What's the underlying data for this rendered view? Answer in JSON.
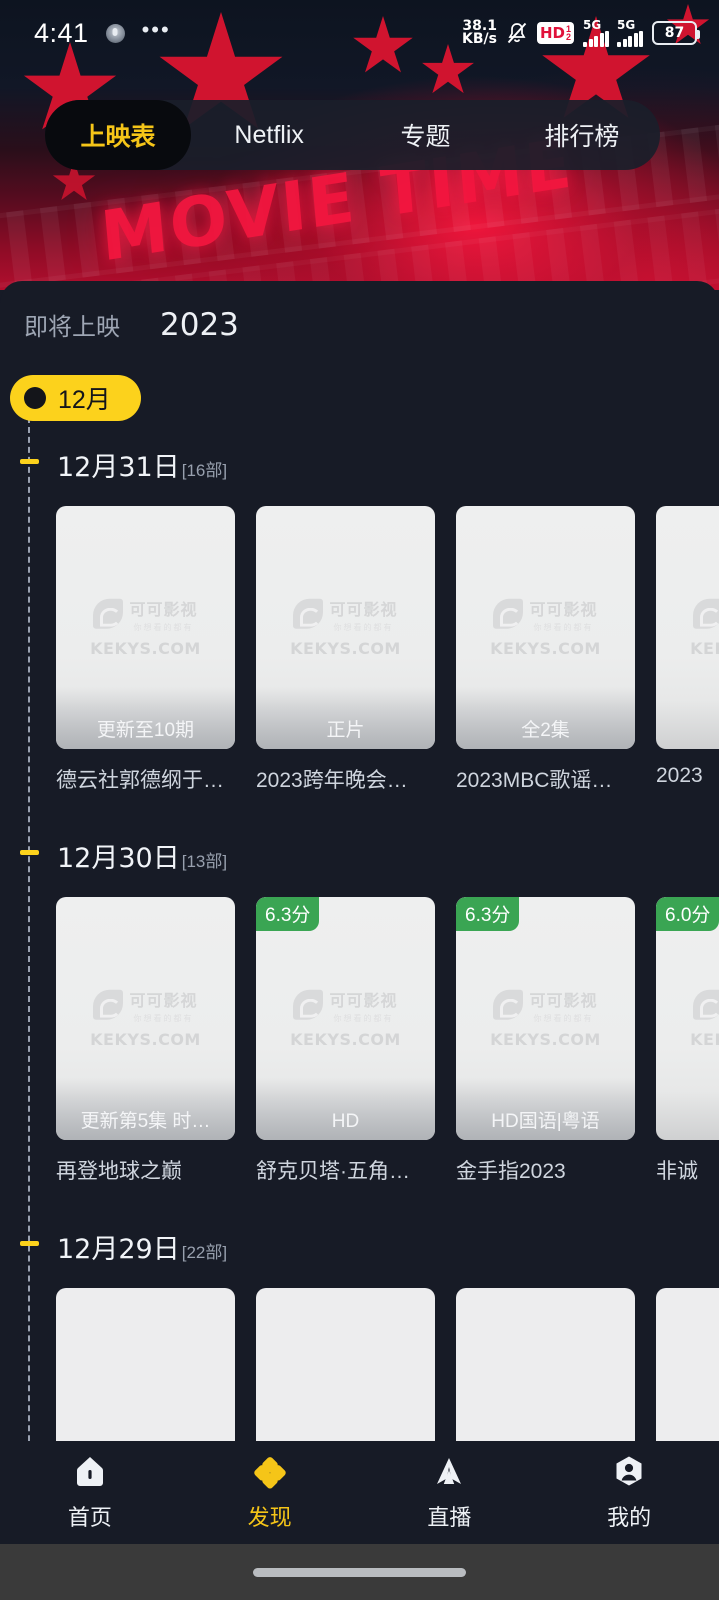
{
  "status_bar": {
    "clock": "4:41",
    "mic_icon": "mic-icon",
    "overflow_icon": "more-dots-icon",
    "net_speed": "38.1",
    "net_speed_unit": "KB/s",
    "bell_icon": "bell-muted-icon",
    "hd_badge": "HD",
    "hd_frac_top": "1",
    "hd_frac_bottom": "2",
    "sim1_net": "5G",
    "sim2_net": "5G",
    "battery": "87"
  },
  "top_tabs": {
    "items": [
      {
        "label": "上映表",
        "active": true
      },
      {
        "label": "Netflix",
        "active": false
      },
      {
        "label": "专题",
        "active": false
      },
      {
        "label": "排行榜",
        "active": false
      }
    ]
  },
  "hero": {
    "artwork_text": "MOVIE TIME"
  },
  "section": {
    "subtitle": "即将上映",
    "year": "2023",
    "month_pill": "12月"
  },
  "timeline": {
    "groups": [
      {
        "date": "12月31日",
        "count": "[16部]",
        "cards": [
          {
            "title": "德云社郭德纲于…",
            "status": "更新至10期",
            "score": "",
            "has_watermark": true
          },
          {
            "title": "2023跨年晚会…",
            "status": "正片",
            "score": "",
            "has_watermark": true
          },
          {
            "title": "2023MBC歌谣…",
            "status": "全2集",
            "score": "",
            "has_watermark": true
          },
          {
            "title": "2023",
            "status": "",
            "score": "",
            "has_watermark": true
          }
        ]
      },
      {
        "date": "12月30日",
        "count": "[13部]",
        "cards": [
          {
            "title": "再登地球之巅",
            "status": "更新第5集 时…",
            "score": "",
            "has_watermark": true
          },
          {
            "title": "舒克贝塔·五角…",
            "status": "HD",
            "score": "6.3分",
            "has_watermark": true
          },
          {
            "title": "金手指2023",
            "status": "HD国语|粤语",
            "score": "6.3分",
            "has_watermark": true
          },
          {
            "title": "非诚",
            "status": "",
            "score": "6.0分",
            "has_watermark": true
          }
        ]
      },
      {
        "date": "12月29日",
        "count": "[22部]",
        "cards": [
          {
            "title": "",
            "status": "",
            "score": "",
            "has_watermark": false
          },
          {
            "title": "",
            "status": "",
            "score": "",
            "has_watermark": false
          },
          {
            "title": "",
            "status": "",
            "score": "",
            "has_watermark": false
          },
          {
            "title": "",
            "status": "",
            "score": "",
            "has_watermark": false
          }
        ]
      }
    ]
  },
  "watermark": {
    "cn": "可可影视",
    "slogan": "你想看的都有",
    "domain": "KEKYS.COM"
  },
  "bottom_nav": {
    "items": [
      {
        "label": "首页",
        "icon": "home-icon",
        "active": false
      },
      {
        "label": "发现",
        "icon": "discover-diamond-icon",
        "active": true
      },
      {
        "label": "直播",
        "icon": "live-broadcast-icon",
        "active": false
      },
      {
        "label": "我的",
        "icon": "profile-person-icon",
        "active": false
      }
    ]
  },
  "colors": {
    "accent_yellow": "#f5c518",
    "pill_yellow": "#fcd21c",
    "score_green": "#3aa553",
    "bg_dark": "#171b26",
    "hero_red": "#d0142f"
  }
}
